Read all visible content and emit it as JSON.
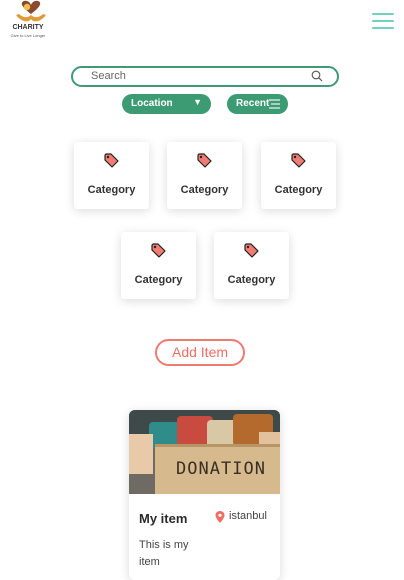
{
  "header": {
    "logo_name": "CHARITY",
    "logo_tagline": "Give to Live Longer",
    "logo_colors": {
      "heart": "#8a4a2e",
      "hands": "#e29a3a"
    },
    "menu_icon": "hamburger-icon",
    "menu_color": "#6fd1c0"
  },
  "search": {
    "placeholder": "Search",
    "value": "",
    "icon": "search-icon",
    "border_color": "#3f9a76"
  },
  "filters": {
    "location_label": "Location",
    "location_icon": "caret-down-icon",
    "recent_label": "Recent",
    "recent_icon": "filter-lines-icon",
    "pill_color": "#3c9b72"
  },
  "categories": [
    {
      "label": "Category",
      "icon": "tag-icon"
    },
    {
      "label": "Category",
      "icon": "tag-icon"
    },
    {
      "label": "Category",
      "icon": "tag-icon"
    },
    {
      "label": "Category",
      "icon": "tag-icon"
    },
    {
      "label": "Category",
      "icon": "tag-icon"
    }
  ],
  "category_icon_color": "#f07c73",
  "add_item": {
    "label": "Add Item",
    "color": "#ef6d64"
  },
  "items": [
    {
      "image_text": "DONATION",
      "title": "My item",
      "location": "istanbul",
      "location_icon": "location-pin-icon",
      "description": "This is my item"
    }
  ]
}
